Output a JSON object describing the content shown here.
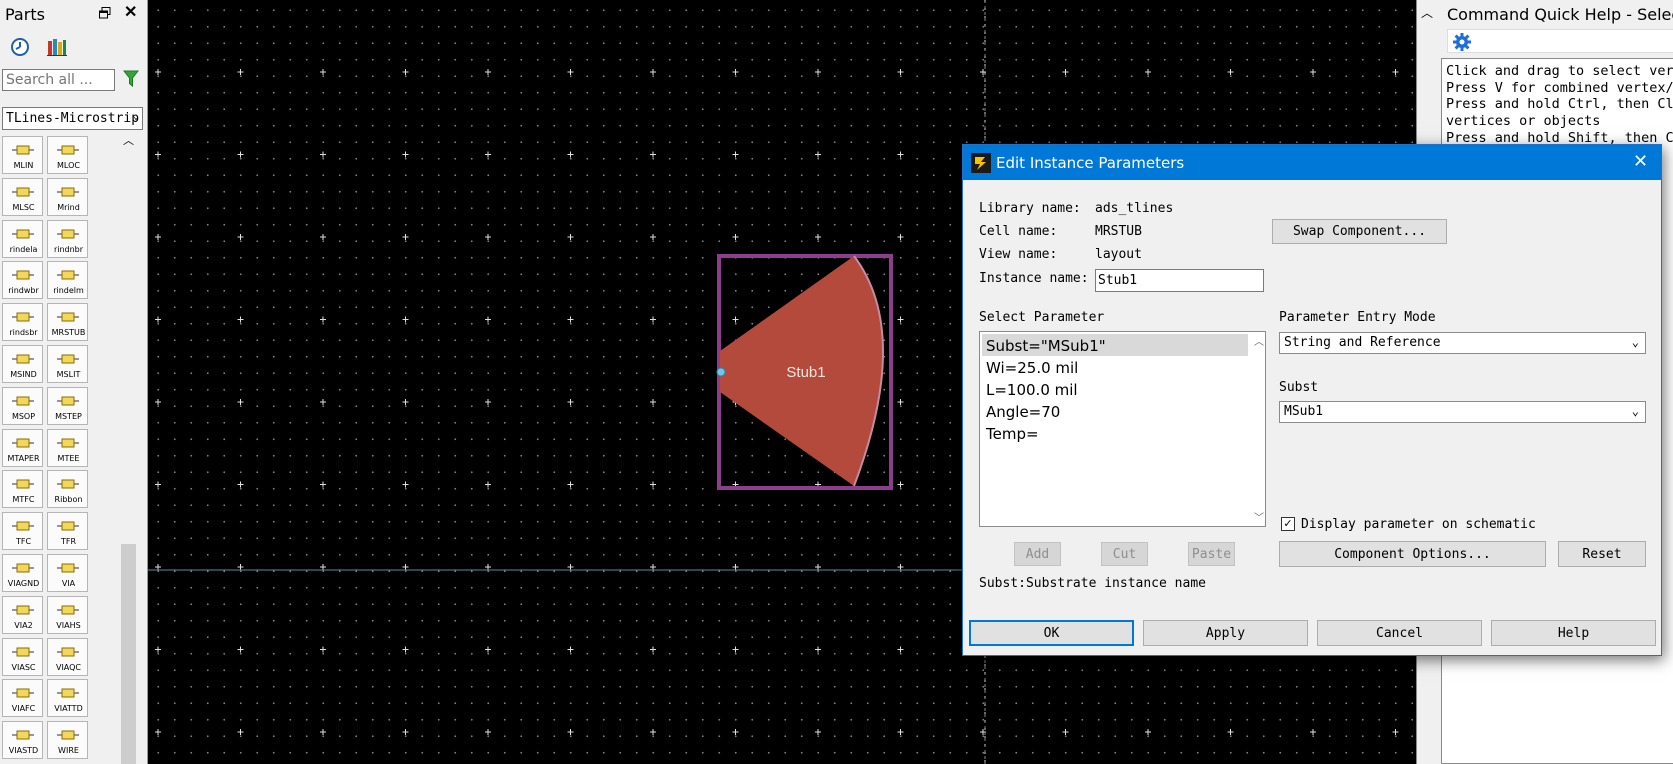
{
  "parts_panel": {
    "title": "Parts",
    "search_placeholder": "Search all ...",
    "library": "TLines-Microstrip",
    "parts": [
      "MLIN",
      "MLOC",
      "MLSC",
      "Mrind",
      "rindela",
      "rindnbr",
      "rindwbr",
      "rindelm",
      "rindsbr",
      "MRSTUB",
      "MSIND",
      "MSLIT",
      "MSOP",
      "MSTEP",
      "MTAPER",
      "MTEE",
      "MTFC",
      "Ribbon",
      "TFC",
      "TFR",
      "VIAGND",
      "VIA",
      "VIA2",
      "VIAHS",
      "VIASC",
      "VIAQC",
      "VIAFC",
      "VIATTD",
      "VIASTD",
      "WIRE"
    ]
  },
  "canvas": {
    "stub_label": "Stub1",
    "stub_color": "#b44a3c",
    "outline_color": "#8c3d8c"
  },
  "help_panel": {
    "title": "Command Quick Help - Select",
    "lines": [
      "Click and drag to select vertices",
      "Press V for combined vertex/edge",
      "Press and hold Ctrl, then Click",
      "vertices or objects",
      "Press and hold Shift, then Click"
    ]
  },
  "dialog": {
    "title": "Edit Instance Parameters",
    "library_label": "Library name:",
    "library_value": "ads_tlines",
    "cell_label": "Cell name:",
    "cell_value": "MRSTUB",
    "view_label": "View name:",
    "view_value": "layout",
    "instance_label": "Instance name:",
    "instance_value": "Stub1",
    "swap_button": "Swap Component...",
    "select_param_label": "Select Parameter",
    "params": [
      "Subst=\"MSub1\"",
      "Wi=25.0 mil",
      "L=100.0 mil",
      "Angle=70",
      "Temp="
    ],
    "entry_mode_label": "Parameter Entry Mode",
    "entry_mode_value": "String and Reference",
    "subst_label": "Subst",
    "subst_value": "MSub1",
    "display_check_label": "Display parameter on schematic",
    "add_button": "Add",
    "cut_button": "Cut",
    "paste_button": "Paste",
    "component_options_button": "Component Options...",
    "reset_button": "Reset",
    "description": "Subst:Substrate instance name",
    "ok_button": "OK",
    "apply_button": "Apply",
    "cancel_button": "Cancel",
    "help_button": "Help"
  }
}
